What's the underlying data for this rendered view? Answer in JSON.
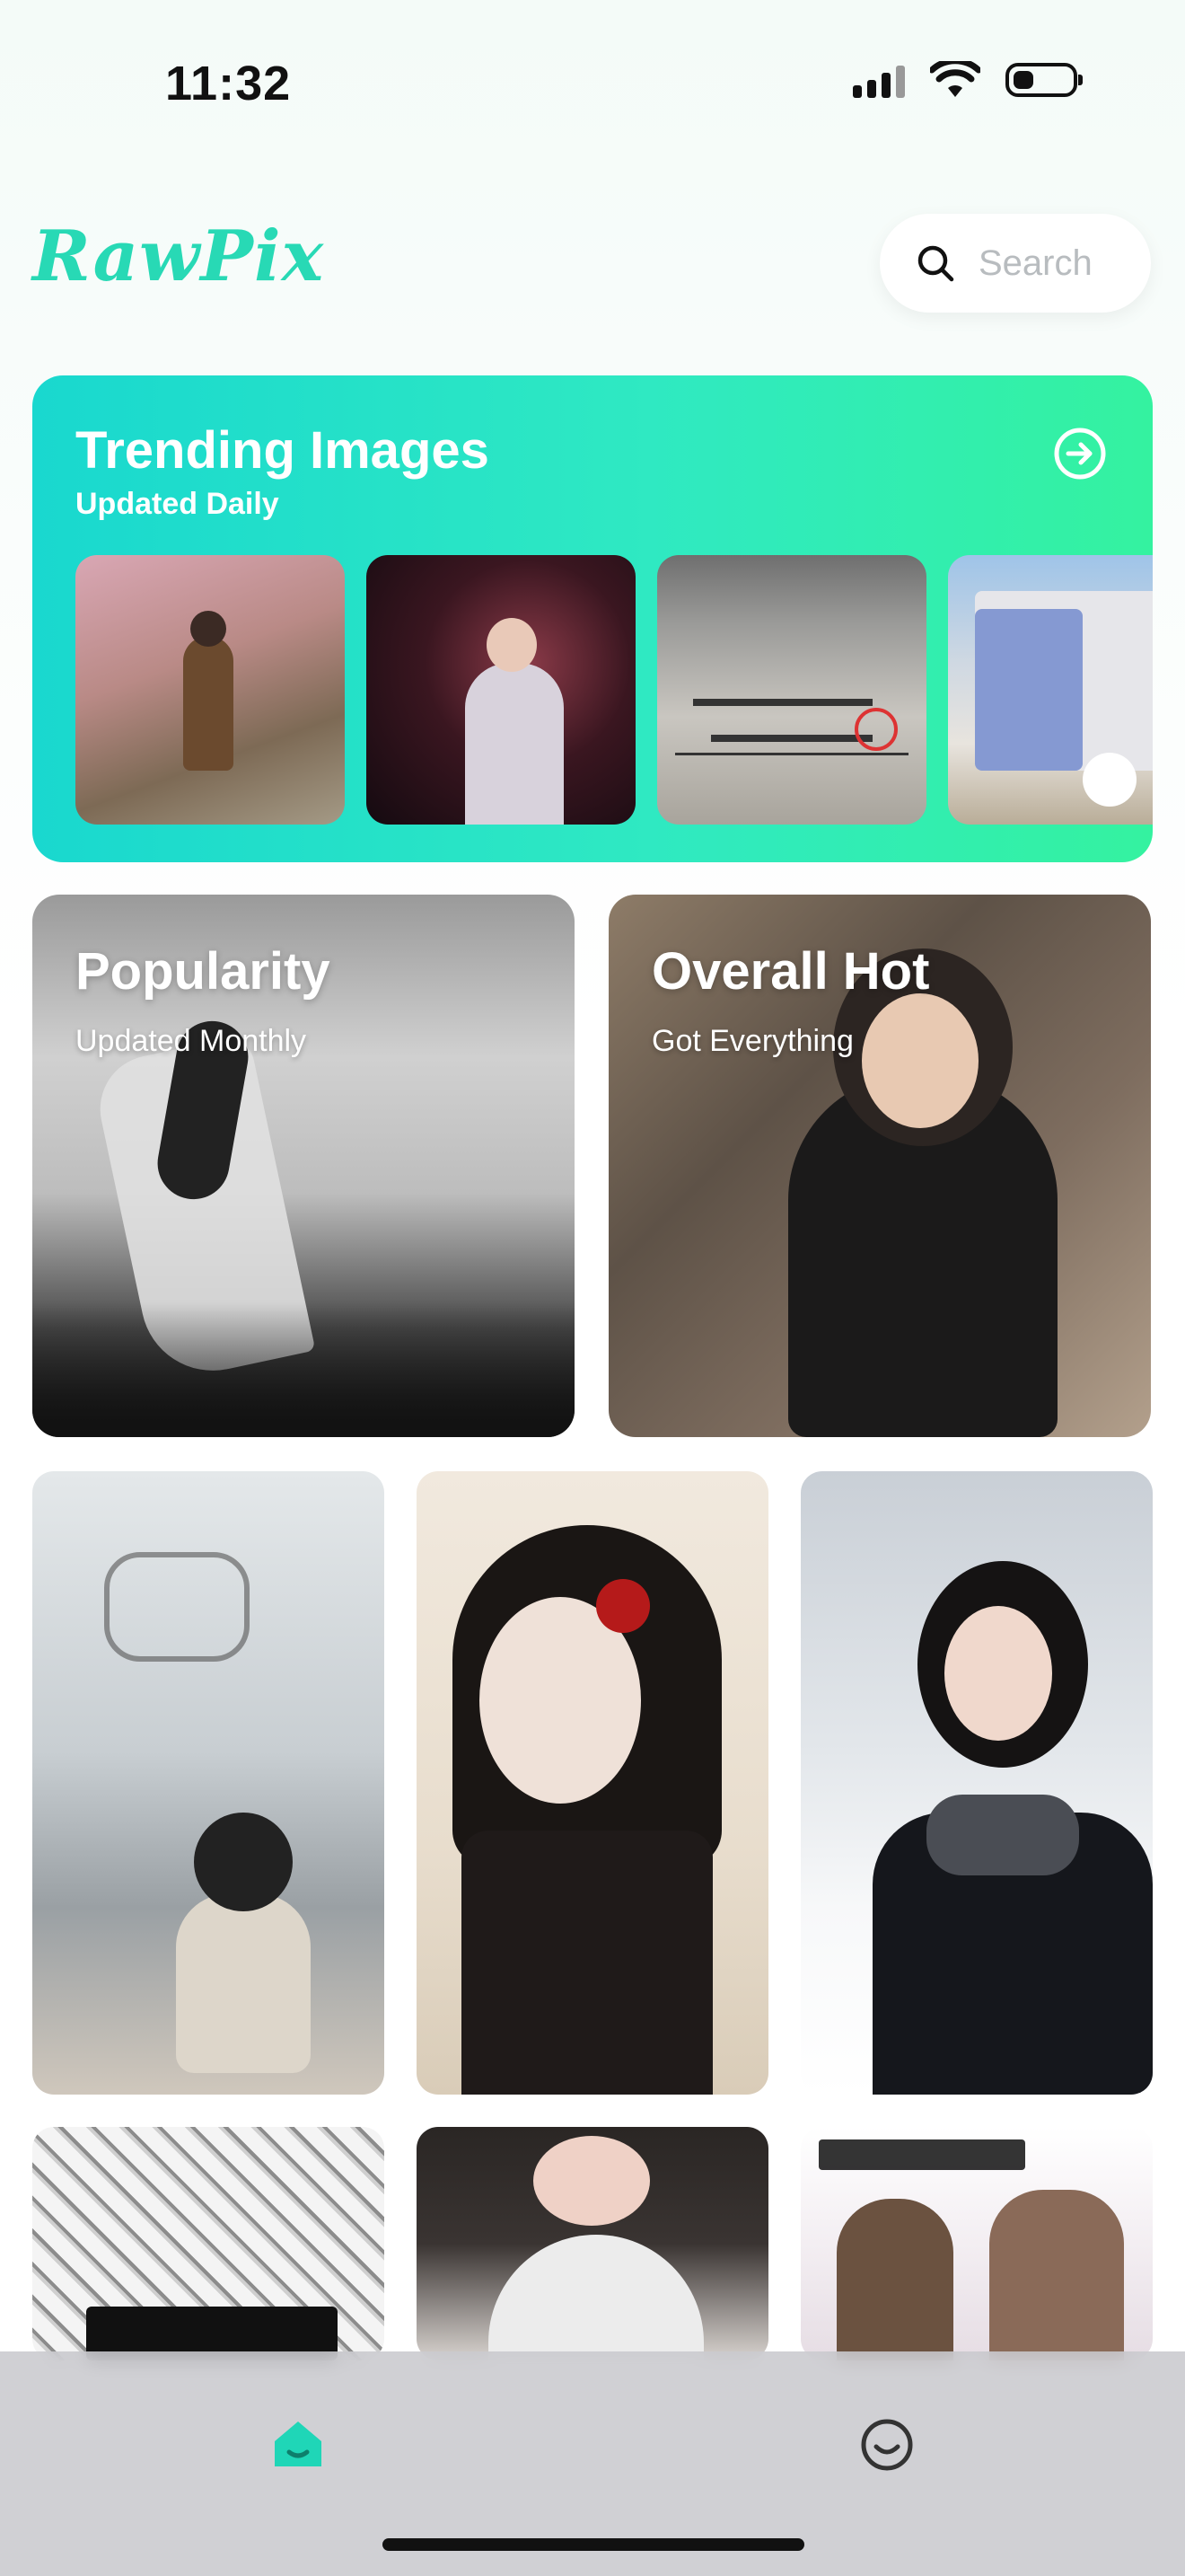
{
  "status_bar": {
    "time": "11:32",
    "icons": [
      "signal-icon",
      "wifi-icon",
      "battery-icon"
    ],
    "battery_level": 0.3
  },
  "header": {
    "logo": "RawPix",
    "search_placeholder": "Search"
  },
  "trending": {
    "title": "Trending Images",
    "subtitle": "Updated Daily",
    "thumbnails": [
      "cherry-blossom-path-photo",
      "night-blossom-portrait-photo",
      "wall-calligraphy-photo",
      "mural-wall-photo"
    ]
  },
  "tiles": [
    {
      "title": "Popularity",
      "subtitle": "Updated Monthly"
    },
    {
      "title": "Overall Hot",
      "subtitle": "Got Everything"
    }
  ],
  "grid": {
    "row1": [
      "foggy-window-photo",
      "ink-portrait-art",
      "snow-portrait-photo"
    ],
    "row2": [
      "manga-collage",
      "portrait-collage",
      "lovely-slides-collage"
    ]
  },
  "tabbar": {
    "items": [
      "home-icon",
      "profile-icon"
    ],
    "active": "home-icon"
  },
  "colors": {
    "accent": "#28d9b5",
    "trending_gradient_start": "#19d8cf",
    "trending_gradient_end": "#34f2a0"
  }
}
